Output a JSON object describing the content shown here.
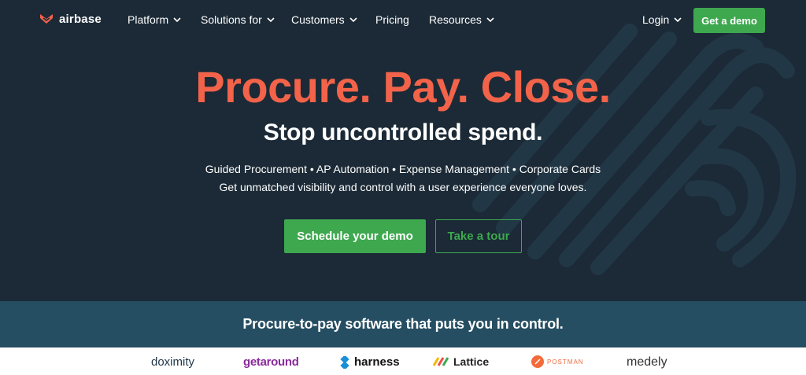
{
  "brand": {
    "logo_text": "airbase",
    "accent": "#f2634a",
    "cta_green": "#3ea84f",
    "bg": "#1b2a36",
    "band_bg": "#264e62"
  },
  "nav": {
    "items": [
      {
        "label": "Platform",
        "has_dropdown": true
      },
      {
        "label": "Solutions for",
        "has_dropdown": true
      },
      {
        "label": "Customers",
        "has_dropdown": true
      },
      {
        "label": "Pricing",
        "has_dropdown": false
      },
      {
        "label": "Resources",
        "has_dropdown": true
      }
    ],
    "login_label": "Login",
    "demo_label": "Get a demo"
  },
  "hero": {
    "headline": "Procure. Pay. Close.",
    "subhead": "Stop uncontrolled spend.",
    "features": "Guided Procurement • AP Automation • Expense Management • Corporate Cards",
    "tagline": "Get unmatched visibility and control with a user experience everyone loves.",
    "primary_cta": "Schedule your demo",
    "secondary_cta": "Take a tour"
  },
  "band": {
    "text": "Procure-to-pay software that puts you in control."
  },
  "customers": {
    "logos": [
      "doximity",
      "getaround",
      "harness",
      "Lattice",
      "POSTMAN",
      "medely"
    ]
  }
}
